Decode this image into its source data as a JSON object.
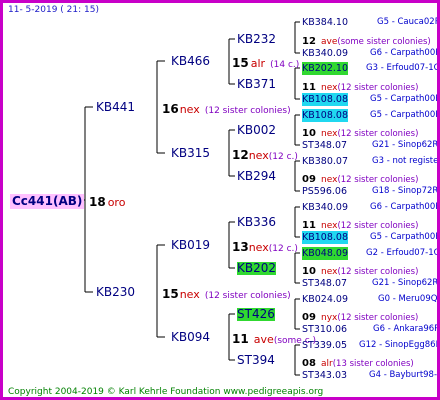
{
  "header_date": "11- 5-2019 ( 21: 15)",
  "footer": "Copyright 2004-2019 © Karl Kehrle Foundation www.pedigreeapis.org",
  "root": {
    "label": "Cc441(AB)",
    "num": "18",
    "ind": "oro"
  },
  "gen1": [
    {
      "label": "KB441",
      "num": "16",
      "ind": "nex",
      "sis": "(12 sister colonies)"
    },
    {
      "label": "KB230",
      "num": "15",
      "ind": "nex",
      "sis": "(12 sister colonies)"
    }
  ],
  "gen2": [
    {
      "label": "KB466",
      "num": "15",
      "ind": "alr",
      "sis": "(14 c.)"
    },
    {
      "label": "KB315",
      "num": "12",
      "ind": "nex",
      "sis": "(12 c.)"
    },
    {
      "label": "KB019",
      "num": "13",
      "ind": "nex",
      "sis": "(12 c.)"
    },
    {
      "label": "KB094",
      "num": "11",
      "ind": "ave",
      "sis": "(some c.)"
    }
  ],
  "gen3": [
    {
      "label": "KB232",
      "num": "12",
      "ind": "ave",
      "sis": "(some sister colonies)",
      "hl": ""
    },
    {
      "label": "KB371",
      "num": "11",
      "ind": "nex",
      "sis": "(12 sister colonies)",
      "hl": ""
    },
    {
      "label": "KB002",
      "num": "10",
      "ind": "nex",
      "sis": "(12 sister colonies)",
      "hl": ""
    },
    {
      "label": "KB294",
      "num": "09",
      "ind": "nex",
      "sis": "(12 sister colonies)",
      "hl": ""
    },
    {
      "label": "KB336",
      "num": "11",
      "ind": "nex",
      "sis": "(12 sister colonies)",
      "hl": ""
    },
    {
      "label": "KB202",
      "num": "10",
      "ind": "nex",
      "sis": "(12 sister colonies)",
      "hl": "green"
    },
    {
      "label": "ST426",
      "num": "09",
      "ind": "nyx",
      "sis": "(12 sister colonies)",
      "hl": "green"
    },
    {
      "label": "ST394",
      "num": "08",
      "ind": "alr",
      "sis": "(13 sister colonies)",
      "hl": ""
    }
  ],
  "gen4": [
    {
      "label": "KB384.10",
      "tag": "G5 - Cauca02R",
      "hl": ""
    },
    {
      "label": "KB340.09",
      "tag": "G6 - Carpath00R",
      "hl": ""
    },
    {
      "label": "KB202.10",
      "tag": "G3 - Erfoud07-1Q",
      "hl": "green"
    },
    {
      "label": "KB108.08",
      "tag": "G5 - Carpath00R",
      "hl": "cyan"
    },
    {
      "label": "KB108.08",
      "tag": "G5 - Carpath00R",
      "hl": "cyan"
    },
    {
      "label": "ST348.07",
      "tag": "G21 - Sinop62R",
      "hl": ""
    },
    {
      "label": "KB380.07",
      "tag": "G3 - not registe",
      "hl": ""
    },
    {
      "label": "PS596.06",
      "tag": "G18 - Sinop72R",
      "hl": ""
    },
    {
      "label": "KB340.09",
      "tag": "G6 - Carpath00R",
      "hl": ""
    },
    {
      "label": "KB108.08",
      "tag": "G5 - Carpath00R",
      "hl": "cyan"
    },
    {
      "label": "KB048.09",
      "tag": "G2 - Erfoud07-1Q",
      "hl": "green"
    },
    {
      "label": "ST348.07",
      "tag": "G21 - Sinop62R",
      "hl": ""
    },
    {
      "label": "KB024.09",
      "tag": "G0 - Meru09Q",
      "hl": ""
    },
    {
      "label": "ST310.06",
      "tag": "G6 - Ankara96R",
      "hl": ""
    },
    {
      "label": "ST339.05",
      "tag": "G12 - SinopEgg86R",
      "hl": ""
    },
    {
      "label": "ST343.03",
      "tag": "G4 - Bayburt98-3",
      "hl": ""
    }
  ]
}
